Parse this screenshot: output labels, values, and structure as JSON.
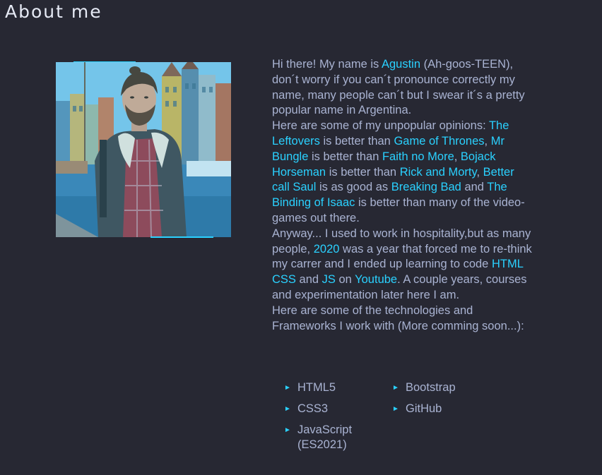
{
  "page": {
    "title": "About me"
  },
  "bio": {
    "p1": [
      {
        "t": "Hi there! My name is "
      },
      {
        "t": "Agustin",
        "hl": true
      },
      {
        "t": " (Ah-goos-TEEN), don´t worry if you can´t pronounce correctly my name, many people can´t but I swear it´s a pretty popular name in Argentina."
      }
    ],
    "p2": [
      {
        "t": "Here are some of my unpopular opinions: "
      },
      {
        "t": "The Leftovers",
        "hl": true
      },
      {
        "t": " is better than "
      },
      {
        "t": "Game of Thrones",
        "hl": true
      },
      {
        "t": ", "
      },
      {
        "t": "Mr Bungle",
        "hl": true
      },
      {
        "t": " is better than "
      },
      {
        "t": "Faith no More",
        "hl": true
      },
      {
        "t": ", "
      },
      {
        "t": "Bojack Horseman",
        "hl": true
      },
      {
        "t": " is better than "
      },
      {
        "t": "Rick and Morty",
        "hl": true
      },
      {
        "t": ", "
      },
      {
        "t": "Better call Saul",
        "hl": true
      },
      {
        "t": " is as good as "
      },
      {
        "t": "Breaking Bad",
        "hl": true
      },
      {
        "t": " and "
      },
      {
        "t": "The Binding of Isaac",
        "hl": true
      },
      {
        "t": " is better than many of the video-games out there."
      }
    ],
    "p3": [
      {
        "t": "Anyway... I used to work in hospitality,but as many people, "
      },
      {
        "t": "2020",
        "hl": true
      },
      {
        "t": " was a year that forced me to re-think my carrer and I ended up learning to code "
      },
      {
        "t": "HTML CSS",
        "hl": true
      },
      {
        "t": " and "
      },
      {
        "t": "JS",
        "hl": true
      },
      {
        "t": " on "
      },
      {
        "t": "Youtube",
        "hl": true
      },
      {
        "t": ". A couple years, courses and experimentation later here I am."
      }
    ],
    "p4": [
      {
        "t": "Here are some of the technologies and Frameworks I work with (More comming soon...):"
      }
    ]
  },
  "technologies": {
    "t0": "HTML5",
    "t1": "Bootstrap",
    "t2": "CSS3",
    "t3": "GitHub",
    "t4": "JavaScript (ES2021)"
  },
  "icons": {
    "bullet": "triangle-right"
  },
  "colors": {
    "background": "#272833",
    "accent": "#2ad1ff",
    "text": "#a9b3d2",
    "title": "#e6eaf5"
  }
}
